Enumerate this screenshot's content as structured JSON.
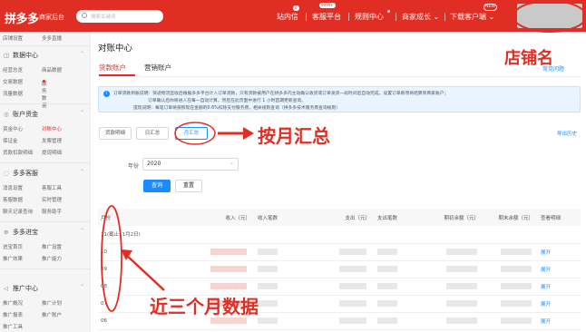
{
  "header": {
    "logo": "拼多多",
    "logo_sub": "商家后台",
    "search_placeholder": "搜索关键词",
    "nav": [
      {
        "label": "站内信",
        "badge": "6"
      },
      {
        "label": "客服平台",
        "badge": "9999+"
      },
      {
        "label": "规则中心",
        "dot": true
      },
      {
        "label": "商家成长 ⌄"
      },
      {
        "label": "下载客户端 ⌄",
        "badge": "NEW"
      }
    ]
  },
  "sidebar": {
    "top_items": [
      "店铺设置",
      "多多直播"
    ],
    "sections": [
      {
        "icon": "◫",
        "title": "数据中心",
        "items": [
          [
            "经营总览",
            "商品数据"
          ],
          [
            "交易数据",
            "服务数据"
          ],
          [
            "流量数据",
            ""
          ]
        ]
      },
      {
        "icon": "◎",
        "title": "账户资金",
        "items": [
          [
            "资金中心",
            "对账中心"
          ],
          [
            "保证金",
            "发票管理"
          ],
          [
            "货款扣款明细",
            "提现明细"
          ]
        ]
      },
      {
        "icon": "◌",
        "title": "多多客服",
        "items": [
          [
            "消息设置",
            "客服工具"
          ],
          [
            "客服数据",
            "实时管理"
          ],
          [
            "聊天记录查询",
            "服务助手"
          ]
        ]
      },
      {
        "icon": "⊕",
        "title": "多多进宝",
        "items": [
          [
            "进宝首页",
            "推广设置"
          ],
          [
            "推广效果",
            "推广能力"
          ]
        ]
      },
      {
        "icon": "◁",
        "title": "推广中心",
        "items": [
          [
            "推广概况",
            "推广计划"
          ],
          [
            "推广报表",
            "推广账户"
          ],
          [
            "推广工具",
            ""
          ]
        ]
      }
    ]
  },
  "main": {
    "title": "对账中心",
    "tabs": [
      "货款账户",
      "营销账户"
    ],
    "help_link": "常见问题",
    "notice": {
      "lines": [
        "订单货款到账说明：快递物流签收后根据多多平台计入订单货款，只有货款被用户在拼多多内主动确认收货或订单发货一段时间后自动完成，设置订单款项将结算到商家账户；",
        "订单确认后你将进入在每一自动计算，然后在此页面中进行 1 小时首期更新查询。",
        "提现说明：每笔订单将按照现在金额的0.6%扣除支付服务费，相关规则查询（拼多多技术服务费查询规则）"
      ]
    },
    "subtabs": [
      "货款明细",
      "日汇总",
      "月汇总"
    ],
    "export_link": "导出历史",
    "filter": {
      "label": "年份",
      "value": "2020",
      "query_button": "查询",
      "reset_button": "重置"
    },
    "table": {
      "headers": [
        "月份",
        "收入（元）",
        "收入笔数",
        "支出（元）",
        "支出笔数",
        "期初余额（元）",
        "期末余额（元）",
        "查看明细"
      ],
      "rows": [
        {
          "month": "11(截止11月2日)",
          "action": ""
        },
        {
          "month": "10",
          "action": "展开"
        },
        {
          "month": "09",
          "action": "展开"
        },
        {
          "month": "08",
          "action": "展开"
        },
        {
          "month": "07",
          "action": "展开"
        },
        {
          "month": "06",
          "action": "展开"
        }
      ]
    }
  },
  "annotations": {
    "shop_name": "店铺名",
    "by_month": "按月汇总",
    "last_three_months": "近三个月数据"
  },
  "colors": {
    "brand": "#e02e24",
    "link": "#1a8cff",
    "primary_button": "#1a8cff",
    "notice_bg": "#e8f4ff"
  }
}
